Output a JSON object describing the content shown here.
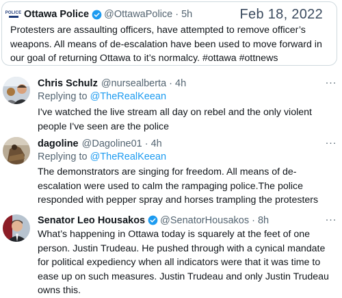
{
  "main_tweet": {
    "display_name": "Ottawa Police",
    "logo_text": "POLICE",
    "handle": "@OttawaPolice",
    "dot": "·",
    "time": "5h",
    "date_stamp": "Feb 18, 2022",
    "text": "Protesters are assaulting officers, have attempted to remove officer’s weapons. All means of de-escalation have been used to move forward in our goal of returning Ottawa to it’s normalcy. #ottawa #ottnews"
  },
  "replies": [
    {
      "display_name": "Chris Schulz",
      "handle": "@nursealberta",
      "dot": "·",
      "time": "4h",
      "more": "···",
      "replying_prefix": "Replying to",
      "replying_to": "@TheRealKeean",
      "text": "I've watched the live stream all day on rebel and the only violent people I've seen are the police"
    },
    {
      "display_name": "dagoline",
      "handle": "@Dagoline01",
      "dot": "·",
      "time": "4h",
      "more": "···",
      "replying_prefix": "Replying to",
      "replying_to": "@TheRealKeean",
      "text": "The demonstrators are singing for freedom. All means of de-escalation were used to calm the rampaging police.The police responded with pepper spray and horses trampling the protesters"
    },
    {
      "display_name": "Senator Leo Housakos",
      "handle": "@SenatorHousakos",
      "dot": "·",
      "time": "8h",
      "more": "···",
      "text": "What’s happening in Ottawa today is squarely at the feet of one person. Justin Trudeau. He pushed through with a cynical mandate for political expediency when all indicators were that it was time to ease up on such measures. Justin Trudeau and only Justin Trudeau owns this."
    }
  ],
  "colors": {
    "link": "#1d9bf0",
    "secondary_text": "#536471",
    "border": "#cfd9de",
    "verified": "#1d9bf0"
  },
  "icons": [
    "ottawa-police-logo-icon",
    "verified-badge-icon",
    "more-options-icon"
  ]
}
